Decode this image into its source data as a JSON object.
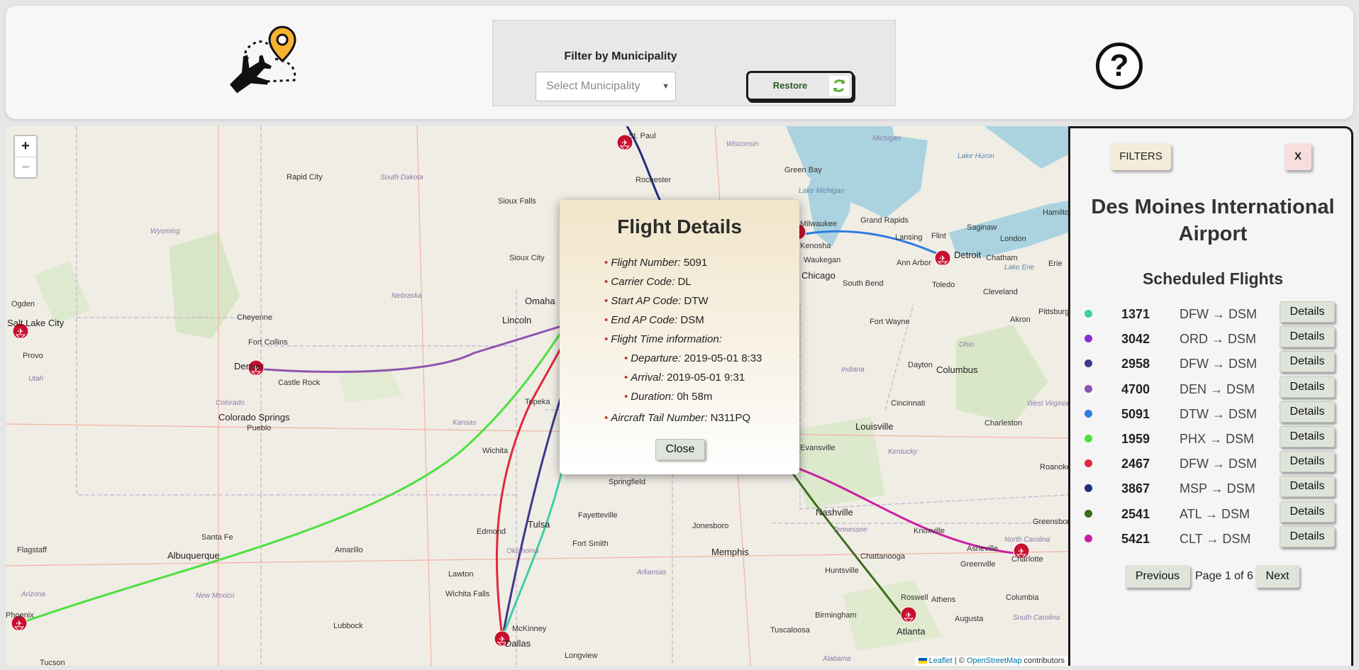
{
  "header": {
    "filter_title": "Filter by Municipality",
    "municipality_placeholder": "Select Municipality",
    "restore_label": "Restore",
    "help_label": "?"
  },
  "map": {
    "zoom_in": "+",
    "zoom_out": "−",
    "attribution": {
      "leaflet": "Leaflet",
      "separator": " | © ",
      "osm": "OpenStreetMap",
      "suffix": " contributors"
    },
    "cities": [
      "St. Paul",
      "Rochester",
      "Rapid City",
      "Sioux Falls",
      "Sioux City",
      "Omaha",
      "Lincoln",
      "Cheyenne",
      "Fort Collins",
      "Denver",
      "Castle Rock",
      "Colorado Springs",
      "Pueblo",
      "Salt Lake City",
      "Ogden",
      "Provo",
      "Topeka",
      "Wichita",
      "Springfield",
      "Tulsa",
      "Fayetteville",
      "Fort Smith",
      "Memphis",
      "Jonesboro",
      "Nashville",
      "Chattanooga",
      "Huntsville",
      "Birmingham",
      "Tuscaloosa",
      "Atlanta",
      "Roswell",
      "Athens",
      "Augusta",
      "Columbia",
      "Charlotte",
      "Greensboro",
      "Greenville",
      "Asheville",
      "Knoxville",
      "Louisville",
      "Cincinnati",
      "Dayton",
      "Columbus",
      "Akron",
      "Cleveland",
      "Pittsburgh",
      "Charleston",
      "Roanoke",
      "Detroit",
      "Toledo",
      "Ann Arbor",
      "Flint",
      "Lansing",
      "Grand Rapids",
      "Saginaw",
      "London",
      "Chatham",
      "Erie",
      "Hamilton",
      "Fort Wayne",
      "South Bend",
      "Chicago",
      "Waukegan",
      "Kenosha",
      "Milwaukee",
      "Green Bay",
      "Albuquerque",
      "Santa Fe",
      "Amarillo",
      "Lubbock",
      "Lawton",
      "Wichita Falls",
      "Edmond",
      "Flagstaff",
      "Phoenix",
      "Tucson",
      "Dallas",
      "McKinney",
      "Longview",
      "Evansville"
    ],
    "states": [
      "Wyoming",
      "South Dakota",
      "Nebraska",
      "Colorado",
      "Kansas",
      "Utah",
      "Arizona",
      "New Mexico",
      "Oklahoma",
      "Arkansas",
      "Tennessee",
      "Kentucky",
      "Indiana",
      "Ohio",
      "West Virginia",
      "North Carolina",
      "South Carolina",
      "Alabama",
      "Wisconsin",
      "Michigan"
    ],
    "water": [
      "Lake Michigan",
      "Lake Huron",
      "Lake Erie"
    ]
  },
  "popup": {
    "title": "Flight Details",
    "flight_number_label": "Flight Number:",
    "flight_number": "5091",
    "carrier_label": "Carrier Code:",
    "carrier": "DL",
    "start_label": "Start AP Code:",
    "start": "DTW",
    "end_label": "End AP Code:",
    "end": "DSM",
    "time_label": "Flight Time information:",
    "departure_label": "Departure:",
    "departure": "2019-05-01 8:33",
    "arrival_label": "Arrival:",
    "arrival": "2019-05-01 9:31",
    "duration_label": "Duration:",
    "duration": "0h 58m",
    "tail_label": "Aircraft Tail Number:",
    "tail": "N311PQ",
    "close_label": "Close"
  },
  "panel": {
    "filters_label": "FILTERS",
    "close_label": "X",
    "airport_name": "Des Moines International Airport",
    "scheduled_title": "Scheduled Flights",
    "details_label": "Details",
    "flights": [
      {
        "number": "1371",
        "route": "DFW → DSM",
        "color": "#3ecfa6"
      },
      {
        "number": "3042",
        "route": "ORD → DSM",
        "color": "#8a2fd0"
      },
      {
        "number": "2958",
        "route": "DFW → DSM",
        "color": "#3d3a8c"
      },
      {
        "number": "4700",
        "route": "DEN → DSM",
        "color": "#8e55b0"
      },
      {
        "number": "5091",
        "route": "DTW → DSM",
        "color": "#2f7be0"
      },
      {
        "number": "1959",
        "route": "PHX → DSM",
        "color": "#4de040"
      },
      {
        "number": "2467",
        "route": "DFW → DSM",
        "color": "#e0283e"
      },
      {
        "number": "3867",
        "route": "MSP → DSM",
        "color": "#1f2f78"
      },
      {
        "number": "2541",
        "route": "ATL → DSM",
        "color": "#3c6e1c"
      },
      {
        "number": "5421",
        "route": "CLT → DSM",
        "color": "#c81fa0"
      }
    ],
    "previous_label": "Previous",
    "page_info": "Page 1 of 6",
    "next_label": "Next"
  }
}
